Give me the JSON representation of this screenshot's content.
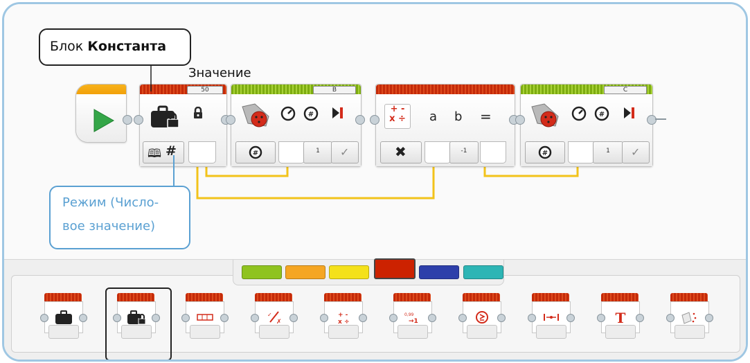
{
  "callouts": {
    "constant_block": {
      "prefix": "Блок ",
      "bold": "Константа"
    },
    "value_label": "Значение",
    "mode_line1": "Режим (Число-",
    "mode_line2": "вое значение)"
  },
  "program": {
    "constant_value": "50",
    "motor1_port": "B",
    "motor1_steering_value": "1",
    "math_value": "-1",
    "math_a": "a",
    "math_b": "b",
    "math_eq": "=",
    "motor2_port": "C",
    "motor2_steering_value": "1"
  },
  "palette": {
    "categories": [
      {
        "name": "action",
        "color": "#8fc31f"
      },
      {
        "name": "flow",
        "color": "#f5a623"
      },
      {
        "name": "sensor",
        "color": "#f4e11a"
      },
      {
        "name": "data",
        "color": "#cc2200",
        "selected": true
      },
      {
        "name": "advanced",
        "color": "#2d3faa"
      },
      {
        "name": "myblocks",
        "color": "#2db5b5"
      }
    ],
    "blocks": [
      {
        "name": "variable-block",
        "icon": "briefcase-icon"
      },
      {
        "name": "constant-block",
        "icon": "locked-briefcase-icon",
        "selected": true
      },
      {
        "name": "array-operations-block",
        "icon": "array-icon"
      },
      {
        "name": "logic-operations-block",
        "icon": "logic-icon"
      },
      {
        "name": "math-block",
        "icon": "math-icon"
      },
      {
        "name": "round-block",
        "icon": "round-icon"
      },
      {
        "name": "compare-block",
        "icon": "compare-icon"
      },
      {
        "name": "range-block",
        "icon": "range-icon"
      },
      {
        "name": "text-block",
        "icon": "text-icon"
      },
      {
        "name": "random-block",
        "icon": "dice-icon"
      }
    ]
  },
  "colors": {
    "frame": "#9fc7e3",
    "wire": "#f2c31a",
    "callout_blue": "#5aa0d2",
    "data_red": "#cc2200",
    "action_green": "#8fc31f"
  }
}
